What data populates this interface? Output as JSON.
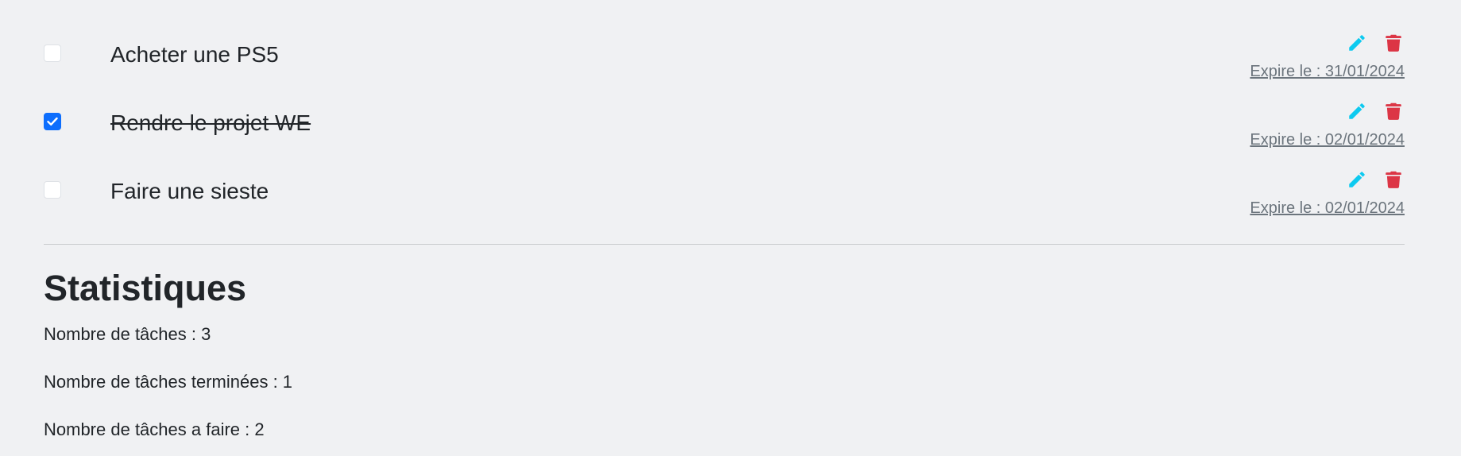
{
  "tasks": [
    {
      "label": "Acheter une PS5",
      "done": false,
      "expire": "Expire le : 31/01/2024"
    },
    {
      "label": "Rendre le projet WE",
      "done": true,
      "expire": "Expire le : 02/01/2024"
    },
    {
      "label": "Faire une sieste",
      "done": false,
      "expire": "Expire le : 02/01/2024"
    }
  ],
  "icons": {
    "edit": "pencil-icon",
    "delete": "trash-icon",
    "check": "check-icon"
  },
  "colors": {
    "edit": "#0dcaf0",
    "delete": "#dc3545",
    "checkbox_checked": "#0d6efd",
    "background": "#f0f1f3"
  },
  "stats": {
    "title": "Statistiques",
    "total": "Nombre de tâches : 3",
    "completed": "Nombre de tâches terminées : 1",
    "todo": "Nombre de tâches a faire : 2"
  }
}
